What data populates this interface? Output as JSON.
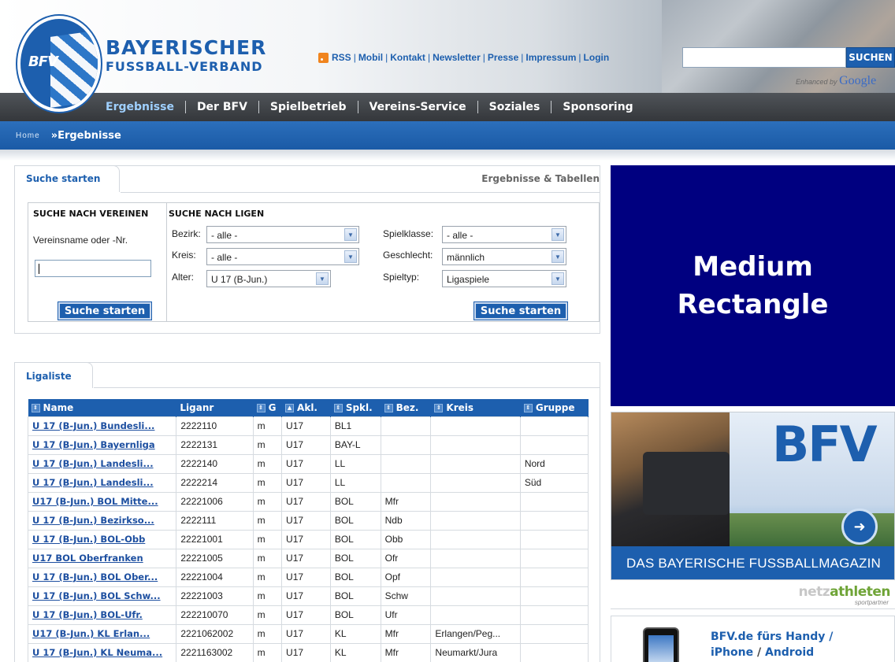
{
  "header": {
    "logo_text": "BFV",
    "brand_line1": "BAYERISCHER",
    "brand_line2": "FUSSBALL-VERBAND",
    "toplinks": [
      "RSS",
      "Mobil",
      "Kontakt",
      "Newsletter",
      "Presse",
      "Impressum",
      "Login"
    ],
    "search_button": "SUCHEN",
    "search_value": "",
    "enhanced_by": "Enhanced by",
    "google": "Google"
  },
  "nav": {
    "items": [
      "Ergebnisse",
      "Der BFV",
      "Spielbetrieb",
      "Vereins-Service",
      "Soziales",
      "Sponsoring"
    ],
    "active": "Ergebnisse"
  },
  "breadcrumb": {
    "home": "Home",
    "current": "»Ergebnisse"
  },
  "search_panel": {
    "tab": "Suche starten",
    "right_title": "Ergebnisse & Tabellen",
    "vereine": {
      "title": "SUCHE NACH VEREINEN",
      "label": "Vereinsname oder -Nr.",
      "value": "",
      "button": "Suche starten"
    },
    "ligen": {
      "title": "SUCHE NACH LIGEN",
      "bezirk_label": "Bezirk:",
      "bezirk_value": "- alle -",
      "kreis_label": "Kreis:",
      "kreis_value": "- alle -",
      "alter_label": "Alter:",
      "alter_value": "U 17 (B-Jun.)",
      "spielklasse_label": "Spielklasse:",
      "spielklasse_value": "- alle -",
      "geschlecht_label": "Geschlecht:",
      "geschlecht_value": "männlich",
      "spieltyp_label": "Spieltyp:",
      "spieltyp_value": "Ligaspiele",
      "button": "Suche starten"
    }
  },
  "ligaliste": {
    "tab": "Ligaliste",
    "columns": [
      "Name",
      "Liganr",
      "G",
      "Akl.",
      "Spkl.",
      "Bez.",
      "Kreis",
      "Gruppe"
    ],
    "rows": [
      [
        "U 17 (B-Jun.) Bundesli...",
        "2222110",
        "m",
        "U17",
        "BL1",
        "",
        "",
        ""
      ],
      [
        "U 17 (B-Jun.) Bayernliga",
        "2222131",
        "m",
        "U17",
        "BAY-L",
        "",
        "",
        ""
      ],
      [
        "U 17 (B-Jun.) Landesli...",
        "2222140",
        "m",
        "U17",
        "LL",
        "",
        "",
        "Nord"
      ],
      [
        "U 17 (B-Jun.) Landesli...",
        "2222214",
        "m",
        "U17",
        "LL",
        "",
        "",
        "Süd"
      ],
      [
        "U17 (B-Jun.) BOL Mitte...",
        "22221006",
        "m",
        "U17",
        "BOL",
        "Mfr",
        "",
        ""
      ],
      [
        "U 17 (B-Jun.) Bezirkso...",
        "2222111",
        "m",
        "U17",
        "BOL",
        "Ndb",
        "",
        ""
      ],
      [
        "U 17 (B-Jun.) BOL-Obb",
        "22221001",
        "m",
        "U17",
        "BOL",
        "Obb",
        "",
        ""
      ],
      [
        "U17 BOL Oberfranken",
        "22221005",
        "m",
        "U17",
        "BOL",
        "Ofr",
        "",
        ""
      ],
      [
        "U 17 (B-Jun.) BOL Ober...",
        "22221004",
        "m",
        "U17",
        "BOL",
        "Opf",
        "",
        ""
      ],
      [
        "U 17 (B-Jun.) BOL Schw...",
        "22221003",
        "m",
        "U17",
        "BOL",
        "Schw",
        "",
        ""
      ],
      [
        "U 17 (B-Jun.) BOL-Ufr.",
        "222210070",
        "m",
        "U17",
        "BOL",
        "Ufr",
        "",
        ""
      ],
      [
        "U17 (B-Jun.) KL Erlan...",
        "2221062002",
        "m",
        "U17",
        "KL",
        "Mfr",
        "Erlangen/Peg...",
        ""
      ],
      [
        "U 17 (B-Jun.) KL Neuma...",
        "2221163002",
        "m",
        "U17",
        "KL",
        "Mfr",
        "Neumarkt/Jura",
        ""
      ]
    ]
  },
  "ads": {
    "rect_line1": "Medium",
    "rect_line2": "Rectangle",
    "bfvtv_logo": "BFV",
    "bfvtv_caption": "DAS BAYERISCHE FUSSBALLMAGAZIN",
    "netz_a": "netz",
    "netz_b": "athleten",
    "netz_sub": "sportpartner",
    "handy_line1": "BFV.de fürs Handy /",
    "handy_line2a": "iPhone",
    "handy_sep": " / ",
    "handy_line2b": "Android"
  },
  "colors": {
    "brand_blue": "#1d5fae",
    "ad_navy": "#000080",
    "nav_dark": "#3c3f43"
  }
}
